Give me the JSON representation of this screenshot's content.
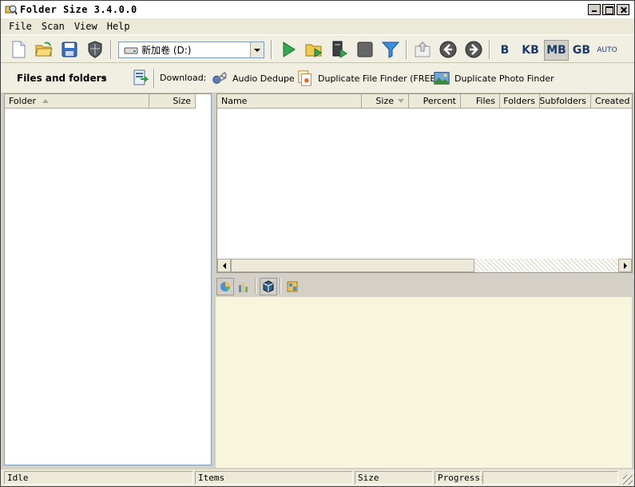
{
  "window": {
    "title": "Folder Size 3.4.0.0"
  },
  "menu": [
    "File",
    "Scan",
    "View",
    "Help"
  ],
  "toolbar": {
    "drive": "新加卷 (D:)",
    "units": [
      "B",
      "KB",
      "MB",
      "GB",
      "AUTO"
    ],
    "selected_unit": "MB"
  },
  "toolbar2": {
    "view_mode": "Files and folders",
    "download_label": "Download:",
    "downloads": [
      "Audio Dedupe",
      "Duplicate File Finder (FREE)",
      "Duplicate Photo Finder"
    ]
  },
  "left_columns": [
    "Folder",
    "Size"
  ],
  "right_columns": [
    "Name",
    "Size",
    "Percent",
    "Files",
    "Folders",
    "Subfolders",
    "Created"
  ],
  "status": {
    "state": "Idle",
    "items_label": "Items",
    "size_label": "Size",
    "progress_label": "Progress:"
  },
  "colors": {
    "chart_bg": "#f7f6dc",
    "accent": "#1b3a6b"
  }
}
